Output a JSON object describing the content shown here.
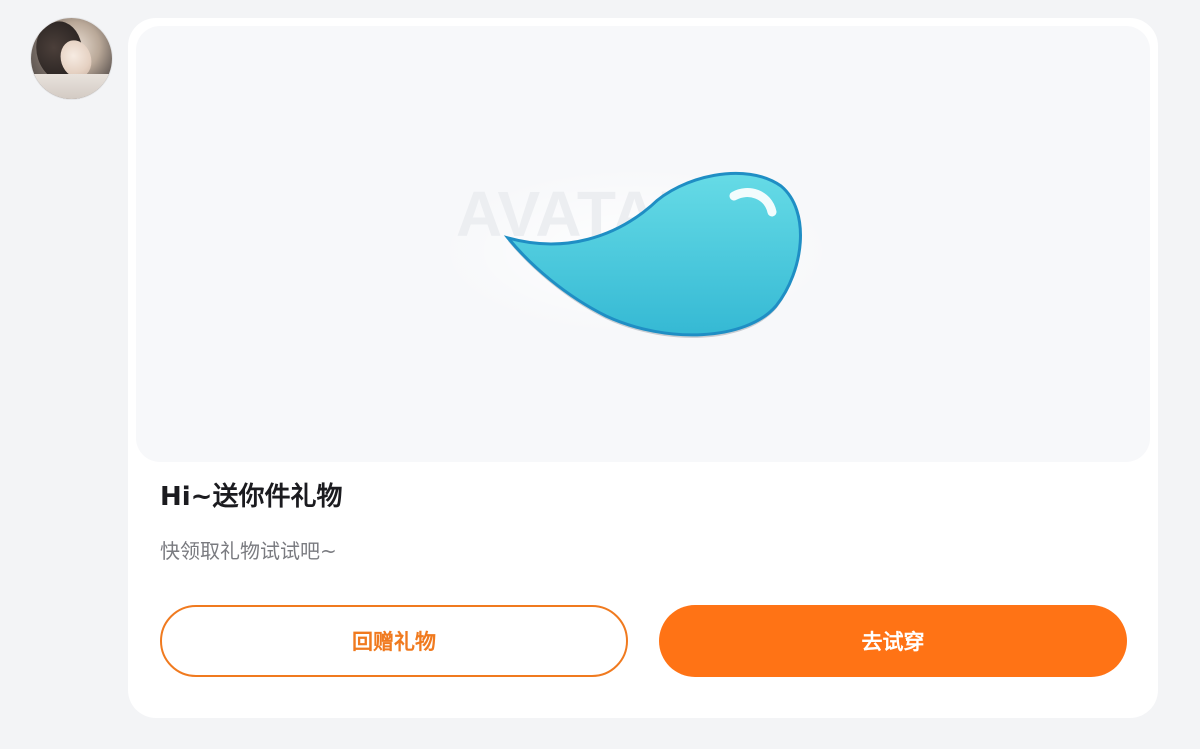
{
  "sender": {
    "avatar_icon": "avatar-photo"
  },
  "gift": {
    "icon": "water-droplet-icon",
    "watermark_text": "AVATAR",
    "colors": {
      "fill_top": "#5fd6e3",
      "fill_bottom": "#2fb6d2",
      "outline": "#1f8ec4"
    }
  },
  "message": {
    "title": "Hi~送你件礼物",
    "subtitle": "快领取礼物试试吧~"
  },
  "actions": {
    "return_gift_label": "回赠礼物",
    "try_on_label": "去试穿"
  },
  "colors": {
    "accent": "#ff7315",
    "accent_outline": "#f07a1f",
    "title_text": "#1b1b1f",
    "subtitle_text": "#7a7b80"
  }
}
